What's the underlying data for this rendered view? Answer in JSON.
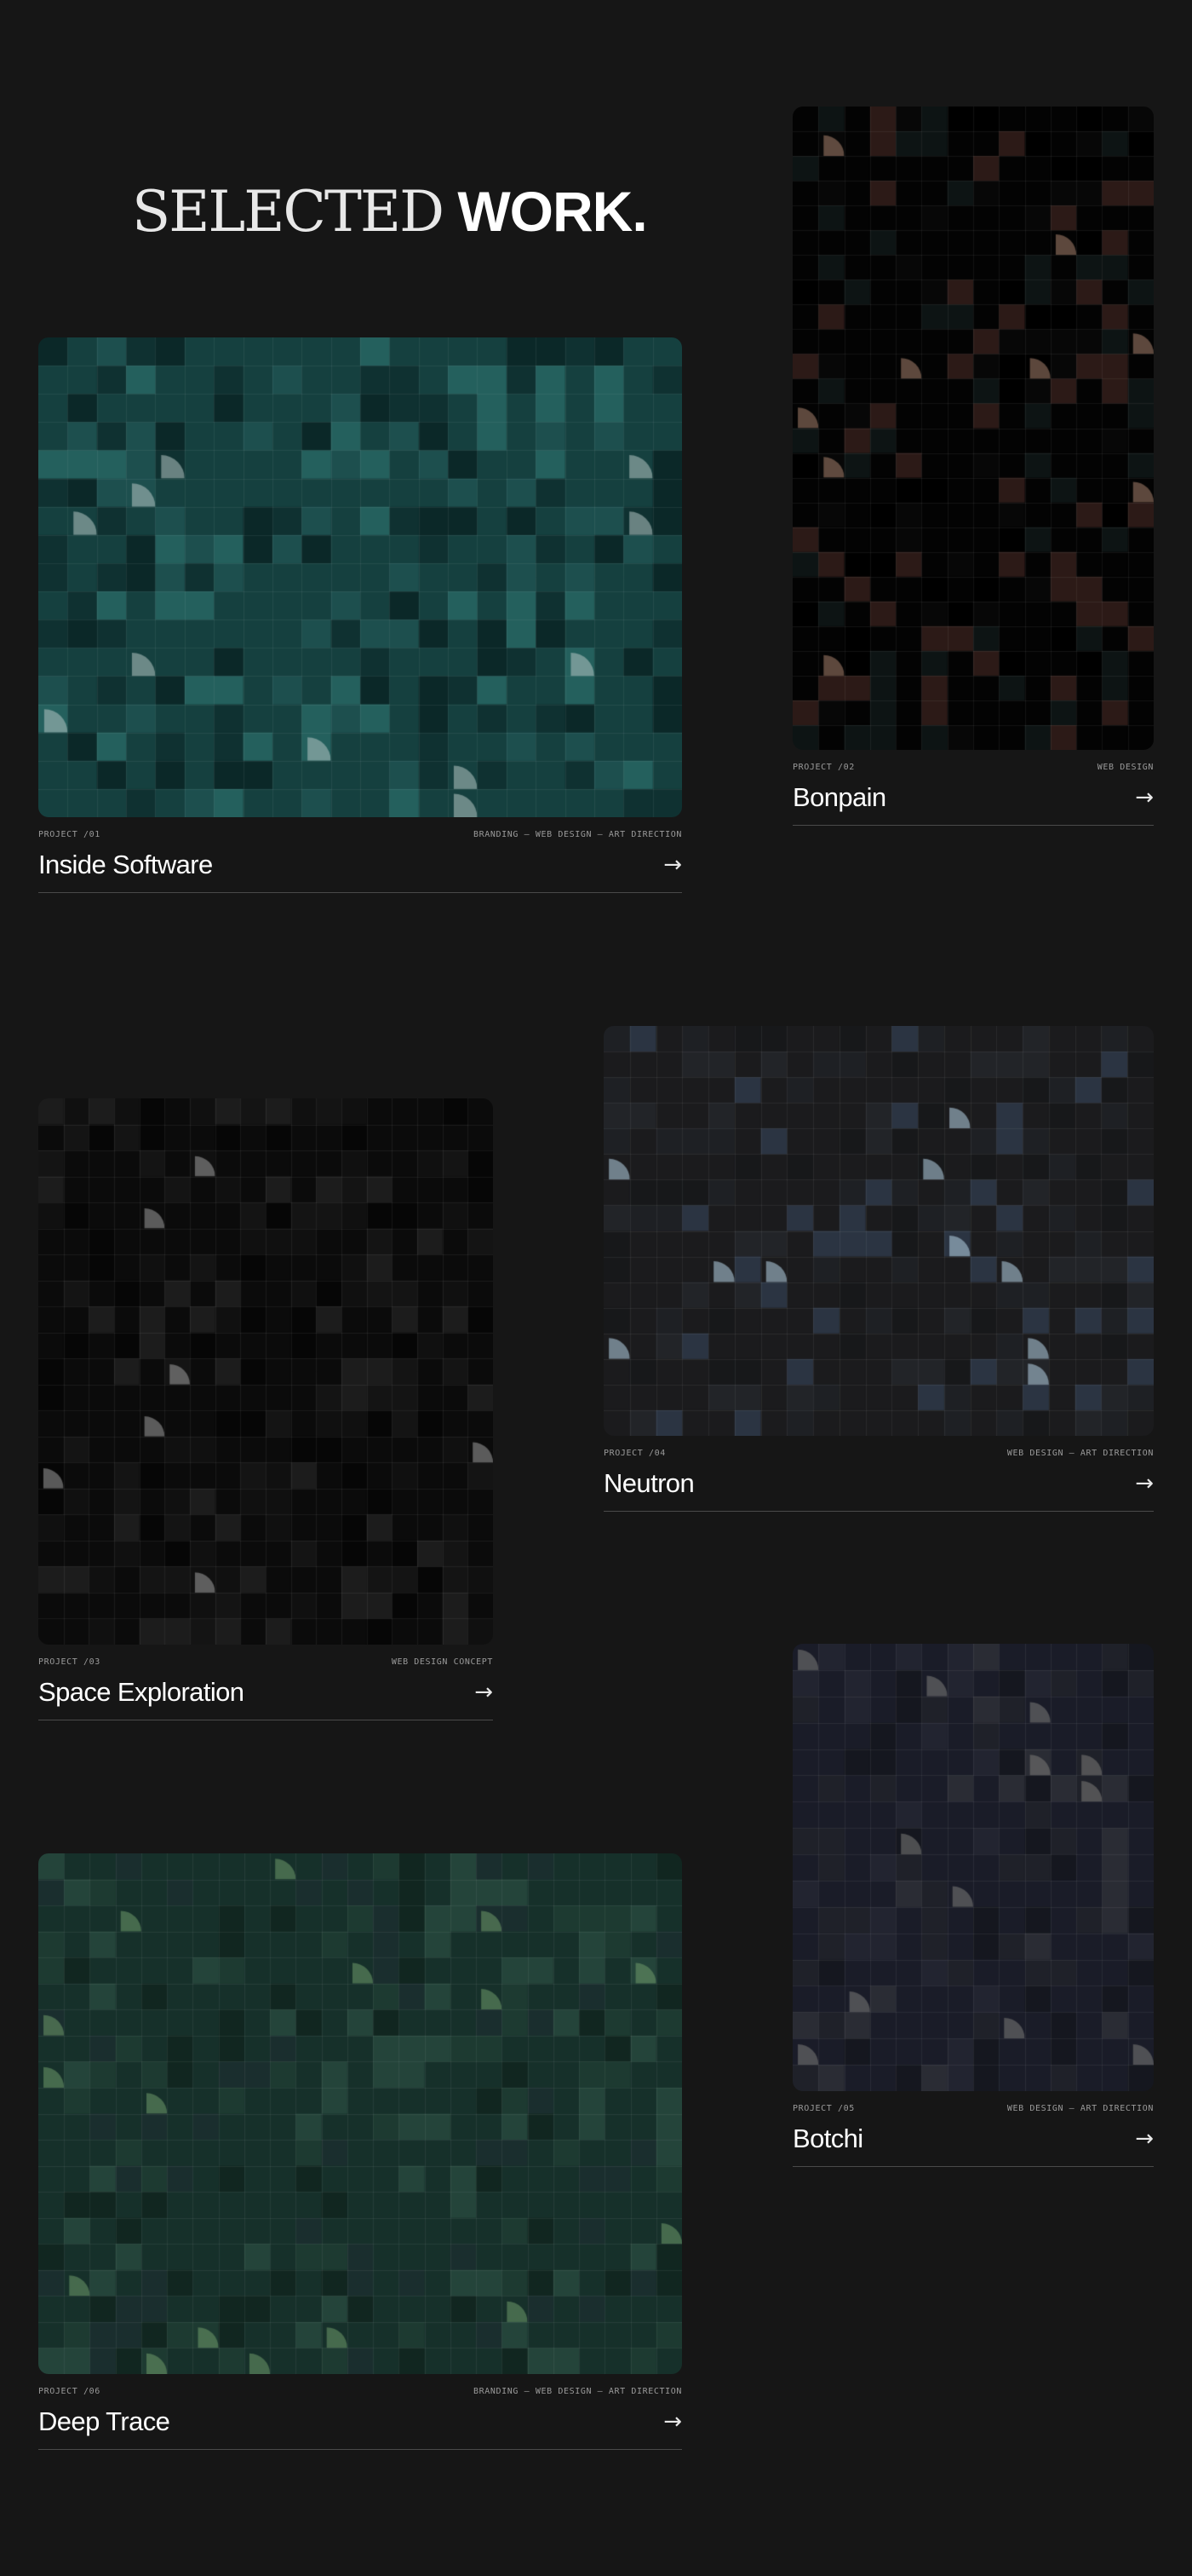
{
  "header": {
    "title_light": "SELECTED",
    "title_bold": "WORK."
  },
  "icons": {
    "arrow": "arrow-right-icon"
  },
  "projects": [
    {
      "index": "PROJECT /01",
      "name": "Inside Software",
      "tags": "BRANDING — WEB DESIGN — ART DIRECTION",
      "arrow": "→",
      "palette": {
        "base": "#15403f",
        "alt": [
          "#1d4f4e",
          "#0f3131",
          "#24605d",
          "#0b2828"
        ],
        "accent": "#b5c5c3"
      }
    },
    {
      "index": "PROJECT /02",
      "name": "Bonpain",
      "tags": "WEB DESIGN",
      "arrow": "→",
      "palette": {
        "base": "#030303",
        "alt": [
          "#070707",
          "#2c1a17",
          "#0d1414",
          "#000000"
        ],
        "accent": "#a7826d"
      }
    },
    {
      "index": "PROJECT /03",
      "name": "Space Exploration",
      "tags": "WEB DESIGN CONCEPT",
      "arrow": "→",
      "palette": {
        "base": "#0b0b0b",
        "alt": [
          "#141414",
          "#060606",
          "#1c1c1c",
          "#101010"
        ],
        "accent": "#9e9e9e"
      }
    },
    {
      "index": "PROJECT /04",
      "name": "Neutron",
      "tags": "WEB DESIGN — ART DIRECTION",
      "arrow": "→",
      "palette": {
        "base": "#1b1b1d",
        "alt": [
          "#222428",
          "#17181a",
          "#2b3442",
          "#1e2024"
        ],
        "accent": "#b7d3e6"
      }
    },
    {
      "index": "PROJECT /05",
      "name": "Botchi",
      "tags": "WEB DESIGN — ART DIRECTION",
      "arrow": "→",
      "palette": {
        "base": "#1a1c28",
        "alt": [
          "#222430",
          "#15171f",
          "#2a2c34",
          "#1f2129"
        ],
        "accent": "#7c7b78"
      }
    },
    {
      "index": "PROJECT /06",
      "name": "Deep Trace",
      "tags": "BRANDING — WEB DESIGN — ART DIRECTION",
      "arrow": "→",
      "palette": {
        "base": "#16302a",
        "alt": [
          "#1d3a31",
          "#112620",
          "#24443a",
          "#1a2e2e"
        ],
        "accent": "#6f9a6a"
      }
    }
  ]
}
